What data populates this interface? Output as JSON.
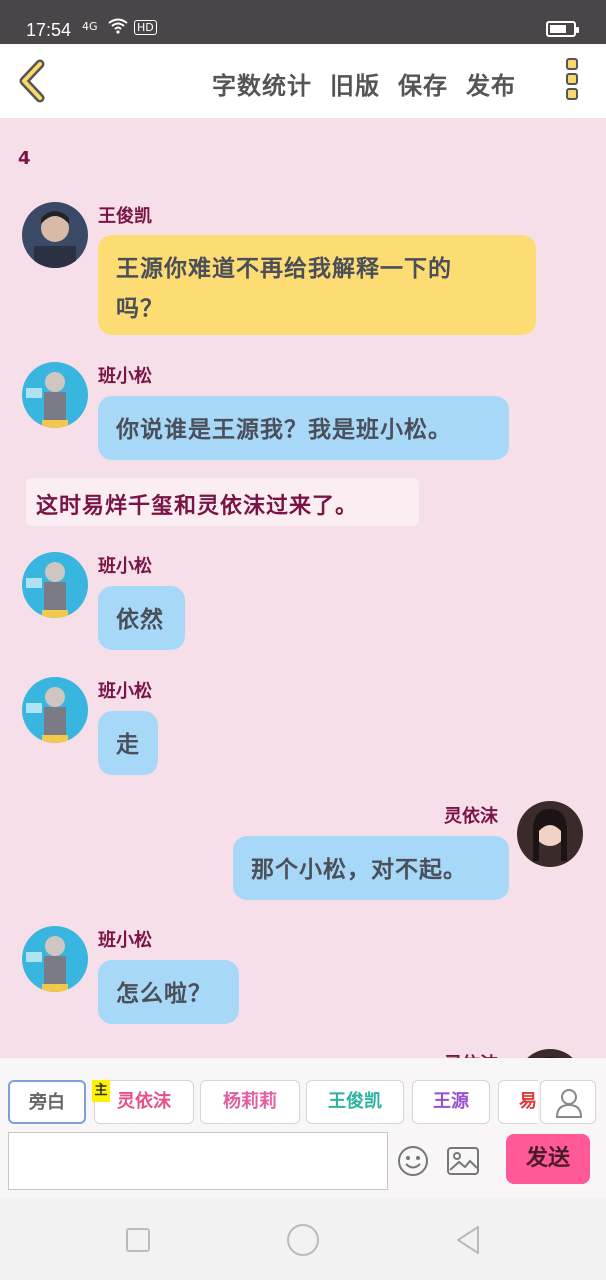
{
  "status_bar": {
    "time": "17:54",
    "signal": "4G",
    "hd": "HD"
  },
  "top_bar": {
    "links": [
      "字数统计",
      "旧版",
      "保存",
      "发布"
    ]
  },
  "chat": {
    "counter": "4",
    "messages": [
      {
        "speaker": "王俊凯",
        "text": "王源你难道不再给我解释一下的吗？",
        "line1": "王源你难道不再给我解释一下的",
        "line2": "吗？"
      },
      {
        "speaker": "班小松",
        "text": "你说谁是王源我？我是班小松。"
      },
      {
        "narration": "这时易烊千玺和灵依沫过来了。"
      },
      {
        "speaker": "班小松",
        "text": "依然"
      },
      {
        "speaker": "班小松",
        "text": "走"
      },
      {
        "speaker": "灵依沫",
        "text": "那个小松，对不起。"
      },
      {
        "speaker": "班小松",
        "text": "怎么啦？"
      },
      {
        "speaker": "灵依沫"
      }
    ]
  },
  "composer": {
    "roles": [
      {
        "label": "旁白",
        "color": "#666666"
      },
      {
        "label": "灵依沫",
        "color": "#e8508a",
        "tag": "主"
      },
      {
        "label": "杨莉莉",
        "color": "#e05fa0"
      },
      {
        "label": "王俊凯",
        "color": "#2bb3a0"
      },
      {
        "label": "王源",
        "color": "#9a4fd0"
      },
      {
        "label": "易",
        "color": "#e03a3a"
      }
    ],
    "send_label": "发送"
  },
  "colors": {
    "background": "#f7dfe9",
    "name": "#7a1444",
    "blue_bubble": "#a8d8f8",
    "yellow_bubble": "#fddd73",
    "send": "#ff5a97"
  }
}
